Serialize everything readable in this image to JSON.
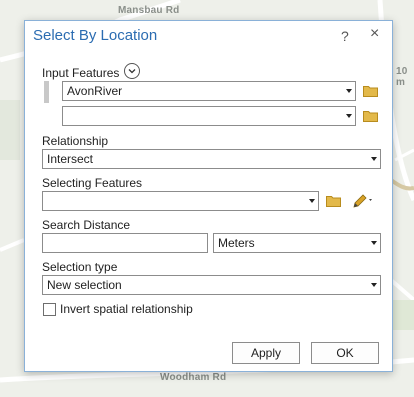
{
  "map": {
    "labels": [
      "Mansbau Rd",
      "10 m",
      "Woodham Rd"
    ]
  },
  "dialog": {
    "title": "Select By Location",
    "help_label": "?",
    "close_label": "×"
  },
  "input_features": {
    "label": "Input Features",
    "rows": [
      "AvonRiver",
      ""
    ]
  },
  "relationship": {
    "label": "Relationship",
    "value": "Intersect"
  },
  "selecting_features": {
    "label": "Selecting Features",
    "value": ""
  },
  "search_distance": {
    "label": "Search Distance",
    "value": "",
    "unit": "Meters"
  },
  "selection_type": {
    "label": "Selection type",
    "value": "New selection"
  },
  "invert": {
    "label": "Invert spatial relationship",
    "checked": false
  },
  "buttons": {
    "apply": "Apply",
    "ok": "OK"
  },
  "colors": {
    "title": "#2b6cb1",
    "dialog_border": "#8ab1d8",
    "folder": "#e3b94a",
    "pencil": "#d9a227"
  }
}
